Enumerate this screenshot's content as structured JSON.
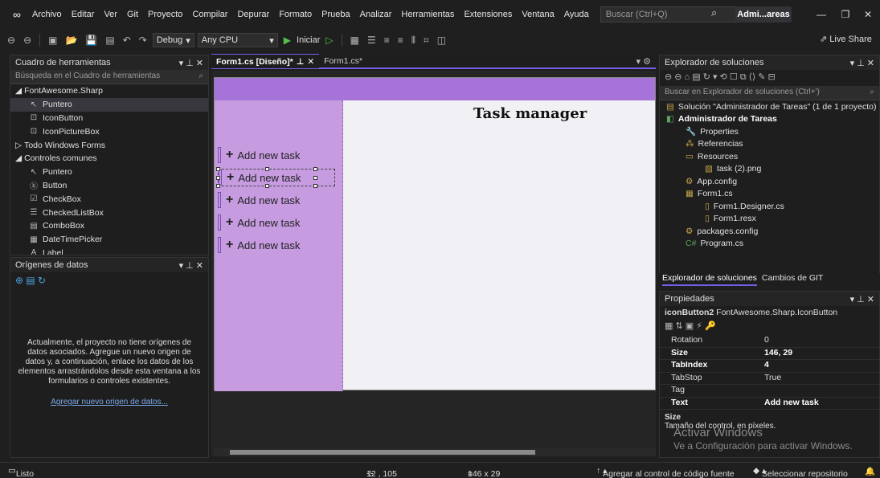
{
  "menubar": {
    "items": [
      "Archivo",
      "Editar",
      "Ver",
      "Git",
      "Proyecto",
      "Compilar",
      "Depurar",
      "Formato",
      "Prueba",
      "Analizar",
      "Herramientas",
      "Extensiones",
      "Ventana",
      "Ayuda"
    ],
    "search_placeholder": "Buscar (Ctrl+Q)",
    "account": "Admi...areas"
  },
  "toolbar": {
    "config": "Debug",
    "platform": "Any CPU",
    "run_label": "Iniciar",
    "live_share": "Live Share"
  },
  "toolbox": {
    "title": "Cuadro de herramientas",
    "search_placeholder": "Búsqueda en el Cuadro de herramientas",
    "items": [
      {
        "label": "FontAwesome.Sharp",
        "kind": "group-open"
      },
      {
        "label": "Puntero",
        "kind": "item",
        "selected": true,
        "icon": "pointer-icon"
      },
      {
        "label": "IconButton",
        "kind": "item",
        "icon": "component-icon"
      },
      {
        "label": "IconPictureBox",
        "kind": "item",
        "icon": "component-icon"
      },
      {
        "label": "Todo Windows Forms",
        "kind": "group-closed"
      },
      {
        "label": "Controles comunes",
        "kind": "group-open"
      },
      {
        "label": "Puntero",
        "kind": "item",
        "icon": "pointer-icon"
      },
      {
        "label": "Button",
        "kind": "item",
        "icon": "button-icon"
      },
      {
        "label": "CheckBox",
        "kind": "item",
        "icon": "checkbox-icon"
      },
      {
        "label": "CheckedListBox",
        "kind": "item",
        "icon": "list-icon"
      },
      {
        "label": "ComboBox",
        "kind": "item",
        "icon": "combobox-icon"
      },
      {
        "label": "DateTimePicker",
        "kind": "item",
        "icon": "calendar-icon"
      },
      {
        "label": "Label",
        "kind": "item",
        "icon": "label-icon"
      }
    ]
  },
  "datasources": {
    "title": "Orígenes de datos",
    "message": "Actualmente, el proyecto no tiene orígenes de datos asociados. Agregue un nuevo origen de datos y, a continuación, enlace los datos de los elementos arrastrándolos desde esta ventana a los formularios o controles existentes.",
    "link": "Agregar nuevo origen de datos..."
  },
  "editor": {
    "tabs": [
      {
        "label": "Form1.cs [Diseño]*",
        "active": true
      },
      {
        "label": "Form1.cs*",
        "active": false
      }
    ]
  },
  "form": {
    "title": "Task manager",
    "task_buttons": [
      "Add new task",
      "Add new task",
      "Add new task",
      "Add new task",
      "Add new task"
    ]
  },
  "solution": {
    "title": "Explorador de soluciones",
    "search_placeholder": "Buscar en Explorador de soluciones (Ctrl+')",
    "rows": [
      {
        "label": "Solución \"Administrador de Tareas\" (1 de 1 proyecto)",
        "level": 0,
        "icon": "solution-icon"
      },
      {
        "label": "Administrador de Tareas",
        "level": 0,
        "bold": true,
        "icon": "csharp-project-icon"
      },
      {
        "label": "Properties",
        "level": 1,
        "icon": "wrench-icon"
      },
      {
        "label": "Referencias",
        "level": 1,
        "icon": "references-icon"
      },
      {
        "label": "Resources",
        "level": 1,
        "icon": "folder-icon"
      },
      {
        "label": "task (2).png",
        "level": 2,
        "icon": "image-icon"
      },
      {
        "label": "App.config",
        "level": 1,
        "icon": "config-icon"
      },
      {
        "label": "Form1.cs",
        "level": 1,
        "icon": "form-icon"
      },
      {
        "label": "Form1.Designer.cs",
        "level": 2,
        "icon": "file-icon"
      },
      {
        "label": "Form1.resx",
        "level": 2,
        "icon": "file-icon"
      },
      {
        "label": "packages.config",
        "level": 1,
        "icon": "config-icon"
      },
      {
        "label": "Program.cs",
        "level": 1,
        "icon": "csharp-file-icon"
      }
    ],
    "bottom_tabs": [
      "Explorador de soluciones",
      "Cambios de GIT"
    ]
  },
  "properties": {
    "title": "Propiedades",
    "object": "iconButton2",
    "object_type": "FontAwesome.Sharp.IconButton",
    "rows": [
      {
        "key": "Rotation",
        "value": "0"
      },
      {
        "key": "Size",
        "value": "146, 29",
        "bold": true
      },
      {
        "key": "TabIndex",
        "value": "4",
        "bold": true
      },
      {
        "key": "TabStop",
        "value": "True"
      },
      {
        "key": "Tag",
        "value": ""
      },
      {
        "key": "Text",
        "value": "Add new task",
        "bold": true
      }
    ],
    "desc_title": "Size",
    "desc_text": "Tamaño del control, en píxeles."
  },
  "watermark": {
    "line1": "Activar Windows",
    "line2": "Ve a Configuración para activar Windows."
  },
  "statusbar": {
    "ready": "Listo",
    "position": "12 , 105",
    "size": "146 x 29",
    "source_control": "Agregar al control de código fuente",
    "repo": "Seleccionar repositorio"
  }
}
